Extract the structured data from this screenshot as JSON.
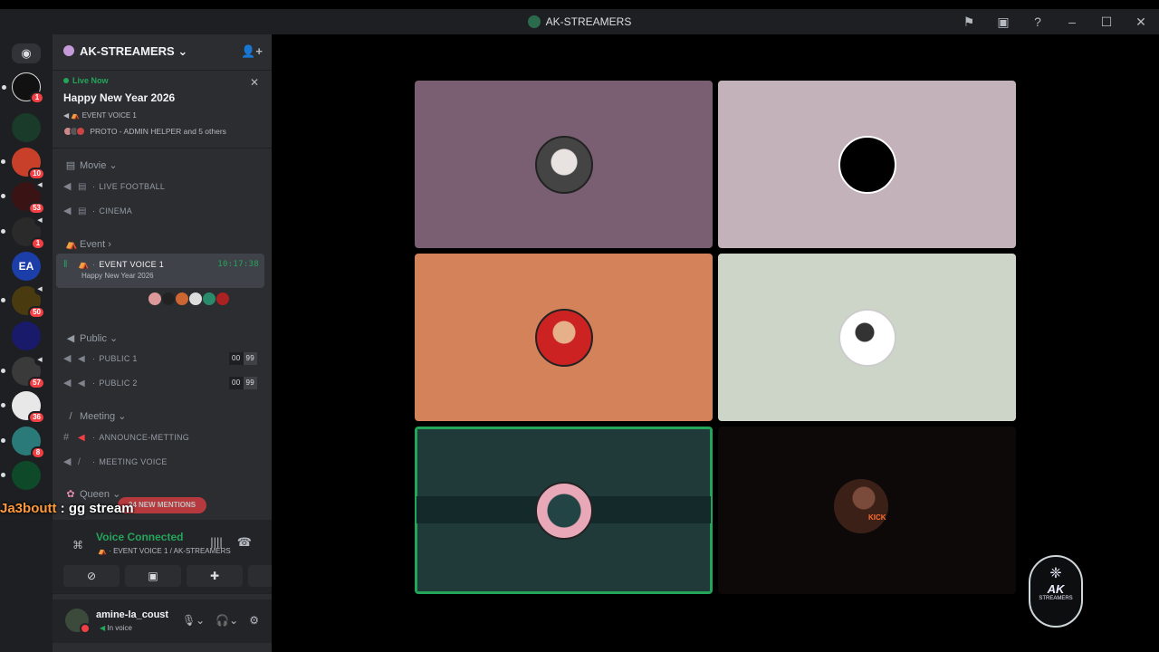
{
  "window": {
    "title": "AK-STREAMERS"
  },
  "rail": {
    "badges": [
      "1",
      "10",
      "53",
      "1",
      "50",
      "57",
      "36",
      "8"
    ]
  },
  "server": {
    "name": "AK-STREAMERS"
  },
  "live_event": {
    "status": "Live Now",
    "title": "Happy New Year 2026",
    "channel": "EVENT VOICE 1",
    "participants": "PROTO - ADMIN HELPER and 5 others"
  },
  "categories": {
    "movie": "Movie",
    "event": "Event",
    "public": "Public",
    "meeting": "Meeting",
    "queen": "Queen"
  },
  "channels": {
    "live_football": "LIVE FOOTBALL",
    "cinema": "CINEMA",
    "event_voice_1": "EVENT VOICE 1",
    "event_voice_1_time": "10:17:38",
    "event_voice_1_sub": "Happy New Year 2026",
    "public_1": "PUBLIC 1",
    "public_1_count": [
      "00",
      "99"
    ],
    "public_2": "PUBLIC 2",
    "public_2_count": [
      "00",
      "99"
    ],
    "announce_metting": "ANNOUNCE-METTING",
    "meeting_voice": "MEETING VOICE"
  },
  "mentions_pill": "24 NEW MENTIONS",
  "stream_chat": {
    "user": "Ja3boutt",
    "message": " : gg stream"
  },
  "voice_panel": {
    "status": "Voice Connected",
    "location": "EVENT VOICE 1 / AK-STREAMERS"
  },
  "user": {
    "name": "amine-la_coust",
    "status": "In voice"
  },
  "stage": {
    "tile_colors": [
      "#7a5e72",
      "#c3b2b9",
      "#d4825a",
      "#cdd5c8",
      "#1f3a39",
      "#0d0908"
    ],
    "kick_label": "KICK",
    "watermark_lines": [
      "AK",
      "STREAMERS"
    ]
  },
  "colors": {
    "accent_green": "#23a55a",
    "badge_red": "#f23f43",
    "sidebar_bg": "#2b2d31",
    "rail_bg": "#1e1f22"
  }
}
